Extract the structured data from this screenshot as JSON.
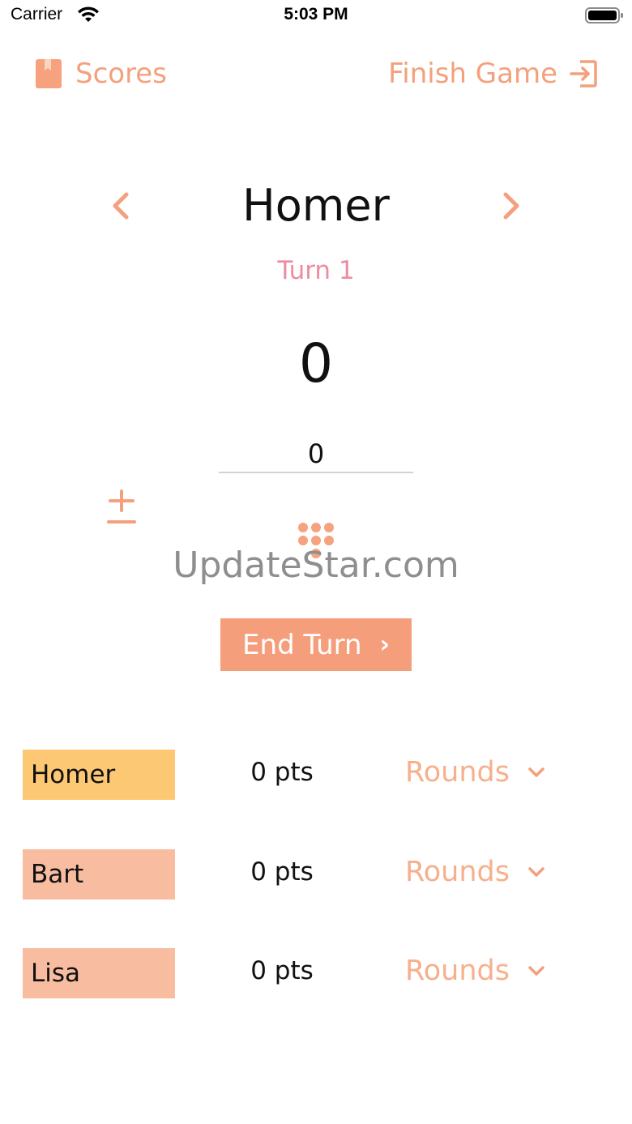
{
  "status_bar": {
    "carrier": "Carrier",
    "time": "5:03 PM",
    "wifi_icon": "wifi-icon",
    "battery_icon": "battery-icon"
  },
  "nav": {
    "scores_label": "Scores",
    "scores_icon": "bookmark-icon",
    "finish_label": "Finish Game",
    "finish_icon": "exit-icon"
  },
  "current_player": {
    "name": "Homer",
    "turn": "Turn 1",
    "score": "0",
    "input_value": "0"
  },
  "controls": {
    "prev_icon": "chevron-left-icon",
    "next_icon": "chevron-right-icon",
    "plusminus_icon": "plus-minus-icon",
    "keypad_icon": "keypad-icon",
    "end_turn_label": "End Turn",
    "end_turn_chevron": "›"
  },
  "watermark": "UpdateStar.com",
  "players": [
    {
      "name": "Homer",
      "pts": "0 pts",
      "rounds_label": "Rounds",
      "color": "#fdc874"
    },
    {
      "name": "Bart",
      "pts": "0 pts",
      "rounds_label": "Rounds",
      "color": "#f8bda1"
    },
    {
      "name": "Lisa",
      "pts": "0 pts",
      "rounds_label": "Rounds",
      "color": "#f8bda1"
    }
  ],
  "colors": {
    "accent": "#f4a07c",
    "turn_pink": "#ee8ca0",
    "button_bg": "#f59e7b"
  }
}
